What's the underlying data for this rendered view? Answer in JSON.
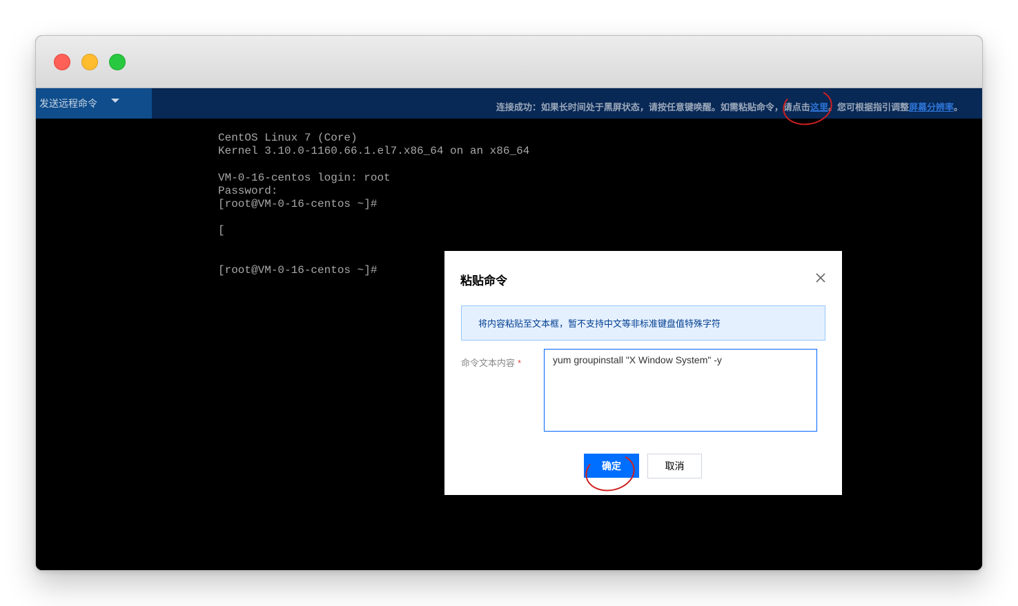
{
  "toolbar": {
    "remote_command_label": "发送远程命令",
    "notice_prefix": "连接成功：如果长时间处于黑屏状态，请按任意键唤醒。如需粘贴命令，请点击",
    "notice_link_here": "这里",
    "notice_middle": "。您可根据指引调整",
    "notice_link_resolution": "屏幕分辨率",
    "notice_suffix": "。"
  },
  "terminal": {
    "lines": "CentOS Linux 7 (Core)\nKernel 3.10.0-1160.66.1.el7.x86_64 on an x86_64\n\nVM-0-16-centos login: root\nPassword:\n[root@VM-0-16-centos ~]#\n\n[\n\n\n[root@VM-0-16-centos ~]#"
  },
  "dialog": {
    "title": "粘贴命令",
    "tip": "将内容粘贴至文本框，暂不支持中文等非标准键盘值特殊字符",
    "field_label": "命令文本内容",
    "required_mark": "*",
    "command_value": "yum groupinstall \"X Window System\" -y",
    "confirm_label": "确定",
    "cancel_label": "取消"
  },
  "colors": {
    "toolbar_bg": "#082855",
    "remote_btn_bg": "#0f4d8c",
    "primary": "#006eff",
    "annotation": "#d11f1f"
  },
  "icons": {
    "close": "close-icon",
    "dropdown": "caret-down-icon"
  }
}
